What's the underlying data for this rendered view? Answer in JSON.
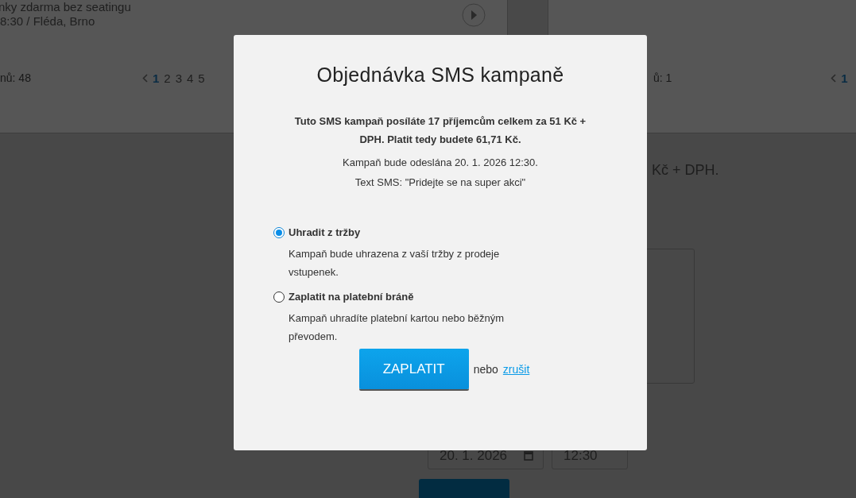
{
  "background": {
    "event": {
      "title": "nky zdarma bez seatingu",
      "subtitle": "8:30 / Fléda, Brno"
    },
    "left_pager": {
      "count": "nů: 48",
      "pages": [
        {
          "label": "1",
          "selected": true
        },
        {
          "label": "2",
          "selected": false
        },
        {
          "label": "3",
          "selected": false
        },
        {
          "label": "4",
          "selected": false
        },
        {
          "label": "5",
          "selected": false
        }
      ]
    },
    "right_pager": {
      "count": "ů: 1",
      "pages": [
        {
          "label": "1",
          "selected": true
        }
      ]
    },
    "price_note": "Kč + DPH.",
    "date_field": {
      "value": "20. 1. 2026"
    },
    "time_field": {
      "value": "12:30"
    }
  },
  "dialog": {
    "title": "Objednávka SMS kampaně",
    "summary": "Tuto SMS kampaň posíláte 17 příjemcům celkem za 51 Kč + DPH. Platit tedy budete 61,71 Kč.",
    "schedule": "Kampaň bude odeslána 20. 1. 2026 12:30.",
    "sms_text": "Text SMS: \"Pridejte se na super akci\"",
    "options": [
      {
        "label": "Uhradit z tržby",
        "description": "Kampaň bude uhrazena z vaší tržby z prodeje vstupenek.",
        "selected": true
      },
      {
        "label": "Zaplatit na platební bráně",
        "description": "Kampaň uhradíte platební kartou nebo běžným převodem.",
        "selected": false
      }
    ],
    "pay_button": "ZAPLATIT",
    "separator": "nebo",
    "cancel_link": "zrušit"
  }
}
